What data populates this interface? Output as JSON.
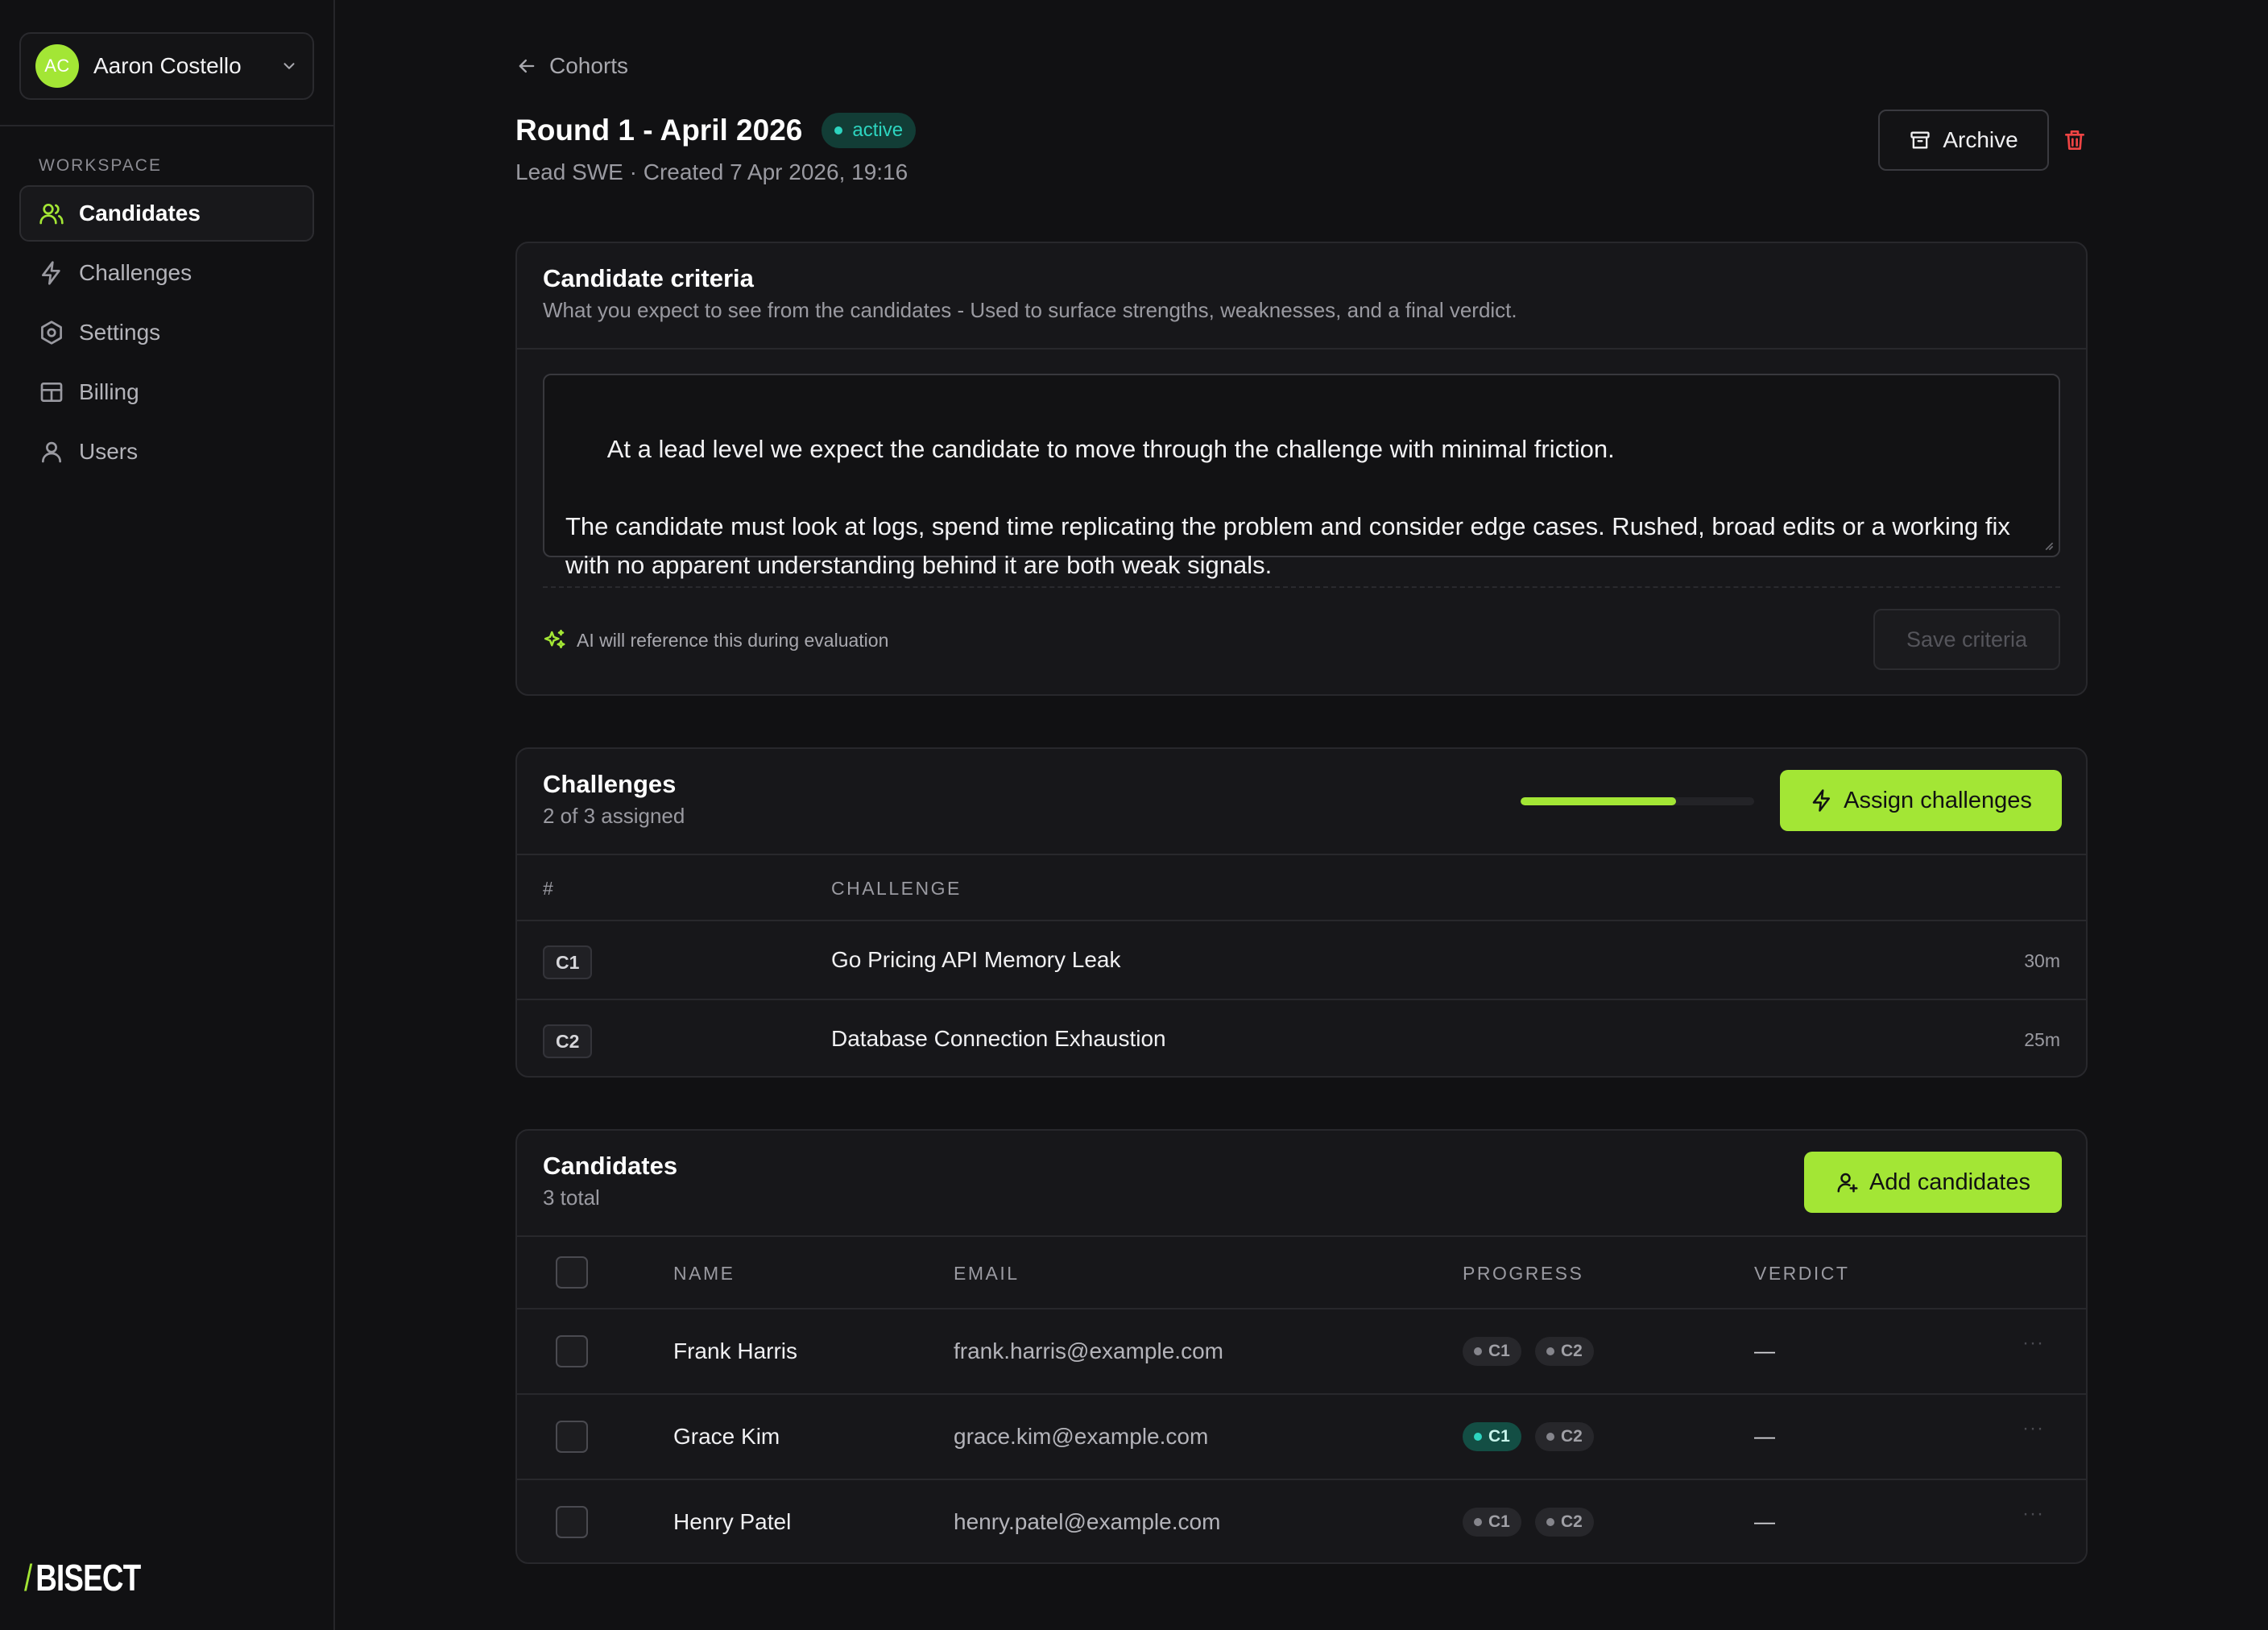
{
  "account": {
    "initials": "AC",
    "name": "Aaron Costello"
  },
  "sidebar": {
    "section_label": "WORKSPACE",
    "items": [
      {
        "label": "Candidates",
        "icon": "users-icon",
        "active": true
      },
      {
        "label": "Challenges",
        "icon": "lightning-icon",
        "active": false
      },
      {
        "label": "Settings",
        "icon": "gear-icon",
        "active": false
      },
      {
        "label": "Billing",
        "icon": "billing-icon",
        "active": false
      },
      {
        "label": "Users",
        "icon": "user-icon",
        "active": false
      }
    ],
    "brand": "BISECT",
    "brand_slash": "/"
  },
  "breadcrumb": {
    "back_label": "Cohorts"
  },
  "header": {
    "title": "Round 1 - April 2026",
    "status": "active",
    "subtitle": "Lead SWE · Created 7 Apr 2026, 19:16",
    "archive_label": "Archive"
  },
  "criteria": {
    "title": "Candidate criteria",
    "description": "What you expect to see from the candidates - Used to surface strengths, weaknesses, and a final verdict.",
    "text": "At a lead level we expect the candidate to move through the challenge with minimal friction.\n\nThe candidate must look at logs, spend time replicating the problem and consider edge cases. Rushed, broad edits or a working fix with no apparent understanding behind it are both weak signals.",
    "ai_note": "AI will reference this during evaluation",
    "save_label": "Save criteria"
  },
  "challenges": {
    "title": "Challenges",
    "summary": "2 of 3 assigned",
    "assigned_fraction": 0.6667,
    "assign_label": "Assign challenges",
    "columns": {
      "num": "#",
      "challenge": "CHALLENGE"
    },
    "rows": [
      {
        "code": "C1",
        "name": "Go Pricing API Memory Leak",
        "duration": "30m"
      },
      {
        "code": "C2",
        "name": "Database Connection Exhaustion",
        "duration": "25m"
      }
    ]
  },
  "candidates": {
    "title": "Candidates",
    "summary": "3 total",
    "add_label": "Add candidates",
    "columns": {
      "name": "NAME",
      "email": "EMAIL",
      "progress": "PROGRESS",
      "verdict": "VERDICT"
    },
    "rows": [
      {
        "name": "Frank Harris",
        "email": "frank.harris@example.com",
        "c1": "C1",
        "c2": "C2",
        "c1_done": false,
        "c2_done": false,
        "verdict": "—",
        "menu": "···"
      },
      {
        "name": "Grace Kim",
        "email": "grace.kim@example.com",
        "c1": "C1",
        "c2": "C2",
        "c1_done": true,
        "c2_done": false,
        "verdict": "—",
        "menu": "···"
      },
      {
        "name": "Henry Patel",
        "email": "henry.patel@example.com",
        "c1": "C1",
        "c2": "C2",
        "c1_done": false,
        "c2_done": false,
        "verdict": "—",
        "menu": "···"
      }
    ]
  },
  "colors": {
    "accent": "#a3e635",
    "status": "#2dd4bf",
    "danger": "#ef4444"
  }
}
